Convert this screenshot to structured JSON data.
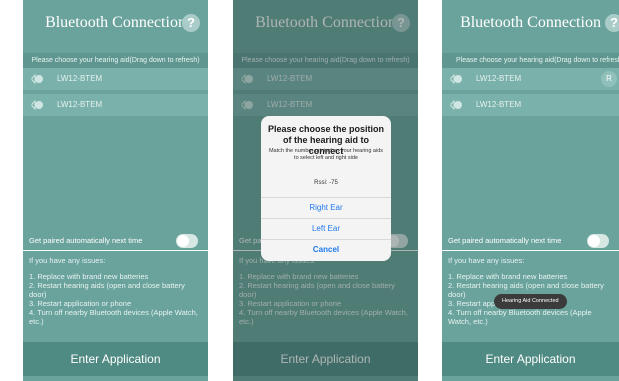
{
  "title": "Bluetooth Connection",
  "help_symbol": "?",
  "hint": "Please choose your hearing aid(Drag down to refresh)",
  "devices": [
    "LW12-BTEM",
    "LW12-BTEM"
  ],
  "right_badge": "R",
  "auto_pair_label": "Get paired automatically next time",
  "issues": {
    "title": "If you have any issues:",
    "items": [
      "1. Replace with brand new batteries",
      "2. Restart hearing aids (open and close battery door)",
      "3. Restart application or phone",
      "4. Turn off nearby Bluetooth devices (Apple Watch, etc.)"
    ]
  },
  "enter_button": "Enter Application",
  "dialog": {
    "title": "Please choose the position of the hearing aid to connect",
    "subtitle": "Match the number printed on your hearing aids to select left and right side",
    "rssi": "Rssi: -75",
    "right_ear": "Right Ear",
    "left_ear": "Left Ear",
    "cancel": "Cancel"
  },
  "toast": "Hearing Aid Connected",
  "colors": {
    "teal": "#6aa39c",
    "accent_blue": "#1f7af0"
  }
}
